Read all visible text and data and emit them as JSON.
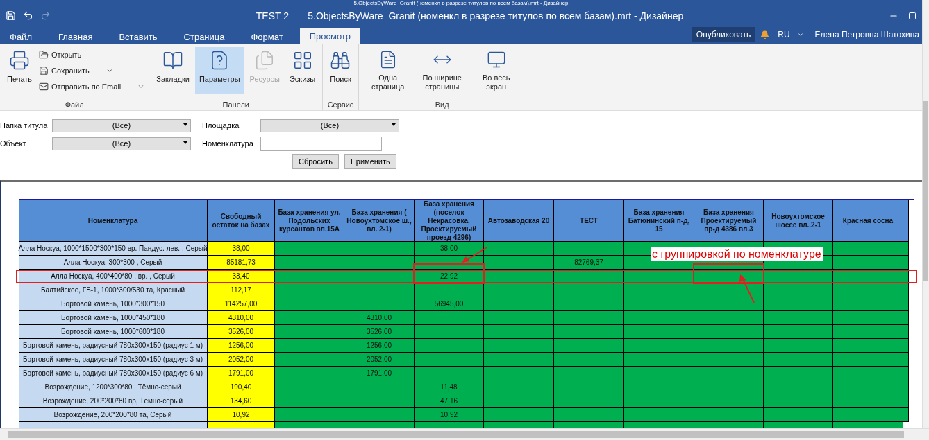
{
  "window": {
    "title_behind": "5.ObjectsByWare_Granit (номенкл в разрезе титулов по всем базам).mrt - Дизайнер",
    "title": "TEST 2 ___5.ObjectsByWare_Granit (номенкл в разрезе титулов по всем базам).mrt - Дизайнер"
  },
  "tabs": [
    {
      "label": "Файл",
      "selected": false
    },
    {
      "label": "Главная",
      "selected": false
    },
    {
      "label": "Вставить",
      "selected": false
    },
    {
      "label": "Страница",
      "selected": false
    },
    {
      "label": "Формат",
      "selected": false
    },
    {
      "label": "Просмотр",
      "selected": true
    }
  ],
  "account": {
    "publish": "Опубликовать",
    "language": "RU",
    "user": "Елена Петровна Шатохина"
  },
  "ribbon": {
    "groups": [
      {
        "label": "Файл",
        "items": [
          {
            "kind": "large",
            "label": "Печать",
            "selected": false,
            "disabled": false
          },
          {
            "kind": "small",
            "label": "Открыть",
            "dropdown": false,
            "disabled": false
          },
          {
            "kind": "small",
            "label": "Сохранить",
            "dropdown": true,
            "disabled": false
          },
          {
            "kind": "small",
            "label": "Отправить по Email",
            "dropdown": true,
            "disabled": false
          }
        ]
      },
      {
        "label": "Панели",
        "items": [
          {
            "kind": "large",
            "label": "Закладки",
            "selected": false,
            "disabled": false
          },
          {
            "kind": "large",
            "label": "Параметры",
            "selected": true,
            "disabled": false
          },
          {
            "kind": "large",
            "label": "Ресурсы",
            "selected": false,
            "disabled": true
          },
          {
            "kind": "large",
            "label": "Эскизы",
            "selected": false,
            "disabled": false
          }
        ]
      },
      {
        "label": "Сервис",
        "items": [
          {
            "kind": "large",
            "label": "Поиск",
            "selected": false,
            "disabled": false
          }
        ]
      },
      {
        "label": "Вид",
        "items": [
          {
            "kind": "large",
            "label": "Одна страница",
            "selected": false,
            "disabled": false
          },
          {
            "kind": "large",
            "label": "По ширине страницы",
            "selected": false,
            "disabled": false
          },
          {
            "kind": "large",
            "label": "Во весь экран",
            "selected": false,
            "disabled": false
          }
        ]
      }
    ]
  },
  "filters": {
    "fields": [
      {
        "kind": "select",
        "label": "Папка титула",
        "value": "(Все)"
      },
      {
        "kind": "select",
        "label": "Площадка",
        "value": "(Все)"
      },
      {
        "kind": "select",
        "label": "Объект",
        "value": "(Все)"
      },
      {
        "kind": "text",
        "label": "Номенклатура"
      }
    ],
    "buttons": [
      "Сбросить",
      "Применить"
    ]
  },
  "table": {
    "columns": [
      "Номенклатура",
      "Свободный остаток на базах",
      "База хранения ул. Подольских курсантов вл.15А",
      "База хранения ( Новоухтомское ш., вл. 2-1)",
      "База хранения (поселок Некрасовка, Проектируемый проезд 4296)",
      "Автозаводская 20",
      "ТЕСТ",
      "База хранения Батюнинский п-д, 15",
      "База хранения Проектируемый пр-д 4386 вл.3",
      "Новоухтомское шоссе вл..2-1",
      "Красная сосна"
    ],
    "rows": [
      {
        "highlighted": false,
        "cells": [
          "Алла Носкуа, 1000*1500*300*150 вр. Пандус. лев. , Серый",
          "38,00",
          "",
          "",
          "38,00",
          "",
          "",
          "",
          "",
          "",
          ""
        ],
        "marked": [
          false,
          false,
          false,
          false,
          false,
          false,
          false,
          false,
          false,
          false,
          false
        ]
      },
      {
        "highlighted": false,
        "cells": [
          "Алла Носкуа, 300*300 , Серый",
          "85181,73",
          "",
          "",
          "",
          "",
          "82769,37",
          "",
          "",
          "",
          ""
        ],
        "marked": [
          false,
          false,
          false,
          false,
          false,
          false,
          false,
          false,
          false,
          false,
          false
        ]
      },
      {
        "highlighted": true,
        "cells": [
          "Алла Носкуа, 400*400*80 , вр. , Серый",
          "33,40",
          "",
          "",
          "22,92",
          "",
          "",
          "",
          "",
          "",
          ""
        ],
        "marked": [
          false,
          false,
          false,
          false,
          true,
          false,
          false,
          false,
          true,
          false,
          false
        ]
      },
      {
        "highlighted": false,
        "cells": [
          "Балтийское, ГБ-1, 1000*300/530 та, Красный",
          "112,17",
          "",
          "",
          "",
          "",
          "",
          "",
          "",
          "",
          ""
        ],
        "marked": [
          false,
          false,
          false,
          false,
          false,
          false,
          false,
          false,
          false,
          false,
          false
        ]
      },
      {
        "highlighted": false,
        "cells": [
          "Бортовой камень, 1000*300*150",
          "114257,00",
          "",
          "",
          "56945,00",
          "",
          "",
          "",
          "",
          "",
          ""
        ],
        "marked": [
          false,
          false,
          false,
          false,
          false,
          false,
          false,
          false,
          false,
          false,
          false
        ]
      },
      {
        "highlighted": false,
        "cells": [
          "Бортовой камень, 1000*450*180",
          "4310,00",
          "",
          "4310,00",
          "",
          "",
          "",
          "",
          "",
          "",
          ""
        ],
        "marked": [
          false,
          false,
          false,
          false,
          false,
          false,
          false,
          false,
          false,
          false,
          false
        ]
      },
      {
        "highlighted": false,
        "cells": [
          "Бортовой камень, 1000*600*180",
          "3526,00",
          "",
          "3526,00",
          "",
          "",
          "",
          "",
          "",
          "",
          ""
        ],
        "marked": [
          false,
          false,
          false,
          false,
          false,
          false,
          false,
          false,
          false,
          false,
          false
        ]
      },
      {
        "highlighted": false,
        "cells": [
          "Бортовой камень, радиусный 780х300х150 (радиус 1 м)",
          "1256,00",
          "",
          "1256,00",
          "",
          "",
          "",
          "",
          "",
          "",
          ""
        ],
        "marked": [
          false,
          false,
          false,
          false,
          false,
          false,
          false,
          false,
          false,
          false,
          false
        ]
      },
      {
        "highlighted": false,
        "cells": [
          "Бортовой камень, радиусный 780х300х150 (радиус 3 м)",
          "2052,00",
          "",
          "2052,00",
          "",
          "",
          "",
          "",
          "",
          "",
          ""
        ],
        "marked": [
          false,
          false,
          false,
          false,
          false,
          false,
          false,
          false,
          false,
          false,
          false
        ]
      },
      {
        "highlighted": false,
        "cells": [
          "Бортовой камень, радиусный 780х300х150 (радиус 6 м)",
          "1791,00",
          "",
          "1791,00",
          "",
          "",
          "",
          "",
          "",
          "",
          ""
        ],
        "marked": [
          false,
          false,
          false,
          false,
          false,
          false,
          false,
          false,
          false,
          false,
          false
        ]
      },
      {
        "highlighted": false,
        "cells": [
          "Возрождение, 1200*300*80 , Тёмно-серый",
          "190,40",
          "",
          "",
          "11,48",
          "",
          "",
          "",
          "",
          "",
          ""
        ],
        "marked": [
          false,
          false,
          false,
          false,
          false,
          false,
          false,
          false,
          false,
          false,
          false
        ]
      },
      {
        "highlighted": false,
        "cells": [
          "Возрождение, 200*200*80 вр, Тёмно-серый",
          "134,60",
          "",
          "",
          "47,16",
          "",
          "",
          "",
          "",
          "",
          ""
        ],
        "marked": [
          false,
          false,
          false,
          false,
          false,
          false,
          false,
          false,
          false,
          false,
          false
        ]
      },
      {
        "highlighted": false,
        "cells": [
          "Возрождение, 200*200*80 та, Серый",
          "10,92",
          "",
          "",
          "10,92",
          "",
          "",
          "",
          "",
          "",
          ""
        ],
        "marked": [
          false,
          false,
          false,
          false,
          false,
          false,
          false,
          false,
          false,
          false,
          false
        ]
      }
    ]
  },
  "annotation": {
    "label": "с группировкой по номенклатуре"
  }
}
